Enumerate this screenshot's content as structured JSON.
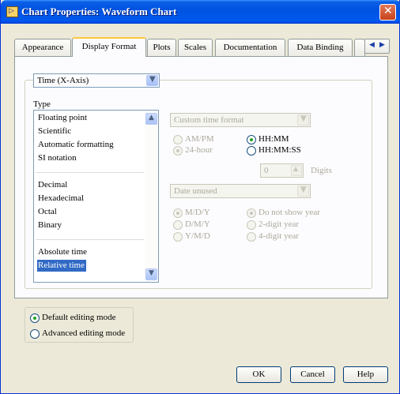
{
  "window": {
    "title": "Chart Properties: Waveform Chart",
    "icon_name": "labview-vi-icon",
    "close_icon": "close-icon"
  },
  "tabs": [
    {
      "label": "Appearance",
      "active": false
    },
    {
      "label": "Display Format",
      "active": true
    },
    {
      "label": "Plots",
      "active": false
    },
    {
      "label": "Scales",
      "active": false
    },
    {
      "label": "Documentation",
      "active": false
    },
    {
      "label": "Data Binding",
      "active": false
    }
  ],
  "axis_select": {
    "value": "Time (X-Axis)"
  },
  "type_section": {
    "label": "Type",
    "groups": [
      [
        "Floating point",
        "Scientific",
        "Automatic formatting",
        "SI notation"
      ],
      [
        "Decimal",
        "Hexadecimal",
        "Octal",
        "Binary"
      ],
      [
        "Absolute time",
        "Relative time"
      ]
    ],
    "selected": "Relative time"
  },
  "time_format": {
    "combo_value": "Custom time format",
    "hour_options": [
      {
        "label": "AM/PM",
        "checked": false
      },
      {
        "label": "24-hour",
        "checked": true
      }
    ],
    "time_options": [
      {
        "label": "HH:MM",
        "checked": true
      },
      {
        "label": "HH:MM:SS",
        "checked": false
      }
    ]
  },
  "digits": {
    "value": "0",
    "label": "Digits"
  },
  "date_format": {
    "combo_value": "Date unused",
    "order_options": [
      {
        "label": "M/D/Y",
        "checked": true
      },
      {
        "label": "D/M/Y",
        "checked": false
      },
      {
        "label": "Y/M/D",
        "checked": false
      }
    ],
    "year_options": [
      {
        "label": "Do not show year",
        "checked": true
      },
      {
        "label": "2-digit year",
        "checked": false
      },
      {
        "label": "4-digit year",
        "checked": false
      }
    ]
  },
  "editing_mode": [
    {
      "label": "Default editing mode",
      "checked": true
    },
    {
      "label": "Advanced editing mode",
      "checked": false
    }
  ],
  "buttons": {
    "ok": "OK",
    "cancel": "Cancel",
    "help": "Help"
  },
  "colors": {
    "title_bar": "#0053e1",
    "selection": "#316ac5",
    "window_bg": "#ece9d8",
    "active_tab_accent": "#ffc83c"
  }
}
